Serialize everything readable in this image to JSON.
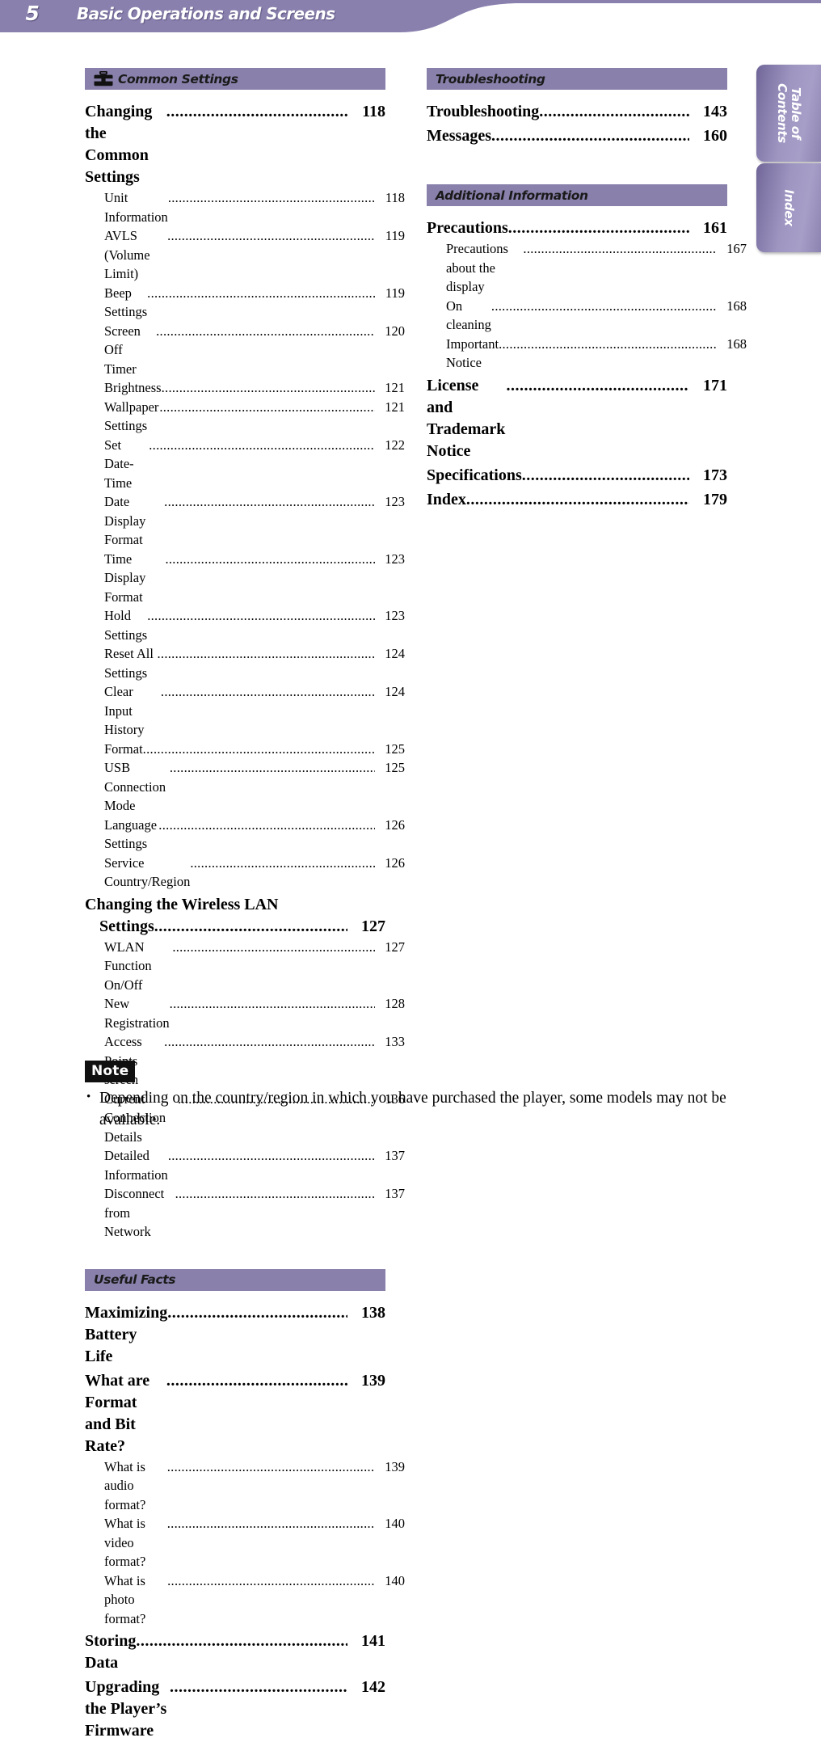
{
  "banner": {
    "page_number": "5",
    "title": "Basic Operations and Screens"
  },
  "side_tabs": [
    {
      "name": "table-of-contents",
      "label": "Table of\nContents"
    },
    {
      "name": "index",
      "label": "Index"
    }
  ],
  "colors": {
    "banner_purple": "#8a80ae",
    "section_bar_purple": "#8980ab",
    "thin_strip_purple": "#bcb6d1",
    "tab_purple": "#9e95c1",
    "note_badge_black": "#101010"
  },
  "left_column": {
    "sections": [
      {
        "bar": {
          "label": "Common Settings",
          "icon": "toolbox-icon"
        },
        "entries": [
          {
            "level": 1,
            "label": "Changing the Common Settings",
            "page": "118"
          },
          {
            "level": 2,
            "label": "Unit Information",
            "page": "118"
          },
          {
            "level": 2,
            "label": "AVLS (Volume Limit)",
            "page": "119"
          },
          {
            "level": 2,
            "label": "Beep Settings",
            "page": "119"
          },
          {
            "level": 2,
            "label": "Screen Off Timer",
            "page": "120"
          },
          {
            "level": 2,
            "label": "Brightness",
            "page": "121"
          },
          {
            "level": 2,
            "label": "Wallpaper Settings",
            "page": "121"
          },
          {
            "level": 2,
            "label": "Set Date-Time",
            "page": "122"
          },
          {
            "level": 2,
            "label": "Date Display Format",
            "page": "123"
          },
          {
            "level": 2,
            "label": "Time Display Format",
            "page": "123"
          },
          {
            "level": 2,
            "label": "Hold Settings",
            "page": "123"
          },
          {
            "level": 2,
            "label": "Reset All Settings",
            "page": "124"
          },
          {
            "level": 2,
            "label": "Clear Input History",
            "page": "124"
          },
          {
            "level": 2,
            "label": "Format",
            "page": "125"
          },
          {
            "level": 2,
            "label": "USB Connection Mode",
            "page": "125"
          },
          {
            "level": 2,
            "label": "Language Settings",
            "page": "126"
          },
          {
            "level": 2,
            "label": "Service Country/Region",
            "page": "126"
          },
          {
            "level": 1,
            "label_line1": "Changing the Wireless LAN",
            "label_line2": "Settings",
            "page": "127",
            "wrap": true
          },
          {
            "level": 2,
            "label": "WLAN Function On/Off",
            "page": "127"
          },
          {
            "level": 2,
            "label": "New Registration",
            "page": "128"
          },
          {
            "level": 2,
            "label": "Access Points screen",
            "page": "133"
          },
          {
            "level": 2,
            "label": "Current Connection Details",
            "page": "136"
          },
          {
            "level": 2,
            "label": "Detailed Information",
            "page": "137"
          },
          {
            "level": 2,
            "label": "Disconnect from Network",
            "page": "137"
          }
        ]
      },
      {
        "bar": {
          "label": "Useful Facts",
          "icon": null
        },
        "entries": [
          {
            "level": 1,
            "label": "Maximizing Battery Life",
            "page": "138"
          },
          {
            "level": 1,
            "label": "What are Format and Bit Rate?",
            "page": "139"
          },
          {
            "level": 2,
            "label": "What is audio format?",
            "page": "139"
          },
          {
            "level": 2,
            "label": "What is video format?",
            "page": "140"
          },
          {
            "level": 2,
            "label": "What is photo format?",
            "page": "140"
          },
          {
            "level": 1,
            "label": "Storing Data",
            "page": "141"
          },
          {
            "level": 1,
            "label": "Upgrading the Player’s Firmware",
            "page": "142"
          }
        ]
      }
    ]
  },
  "right_column": {
    "sections": [
      {
        "bar": {
          "label": "Troubleshooting",
          "icon": null
        },
        "entries": [
          {
            "level": 1,
            "label": "Troubleshooting",
            "page": "143"
          },
          {
            "level": 1,
            "label": "Messages",
            "page": "160"
          }
        ]
      },
      {
        "bar": {
          "label": "Additional Information",
          "icon": null
        },
        "entries": [
          {
            "level": 1,
            "label": "Precautions",
            "page": "161"
          },
          {
            "level": 2,
            "label": "Precautions about the display",
            "page": "167"
          },
          {
            "level": 2,
            "label": "On cleaning",
            "page": "168"
          },
          {
            "level": 2,
            "label": "Important Notice",
            "page": "168"
          },
          {
            "level": 1,
            "label": "License and Trademark Notice",
            "page": "171"
          },
          {
            "level": 1,
            "label": "Specifications",
            "page": "173"
          },
          {
            "level": 1,
            "label": "Index",
            "page": "179"
          }
        ]
      }
    ]
  },
  "note": {
    "badge": "Note",
    "items": [
      "Depending on the country/region in which you have purchased the player, some models may not be available."
    ]
  }
}
